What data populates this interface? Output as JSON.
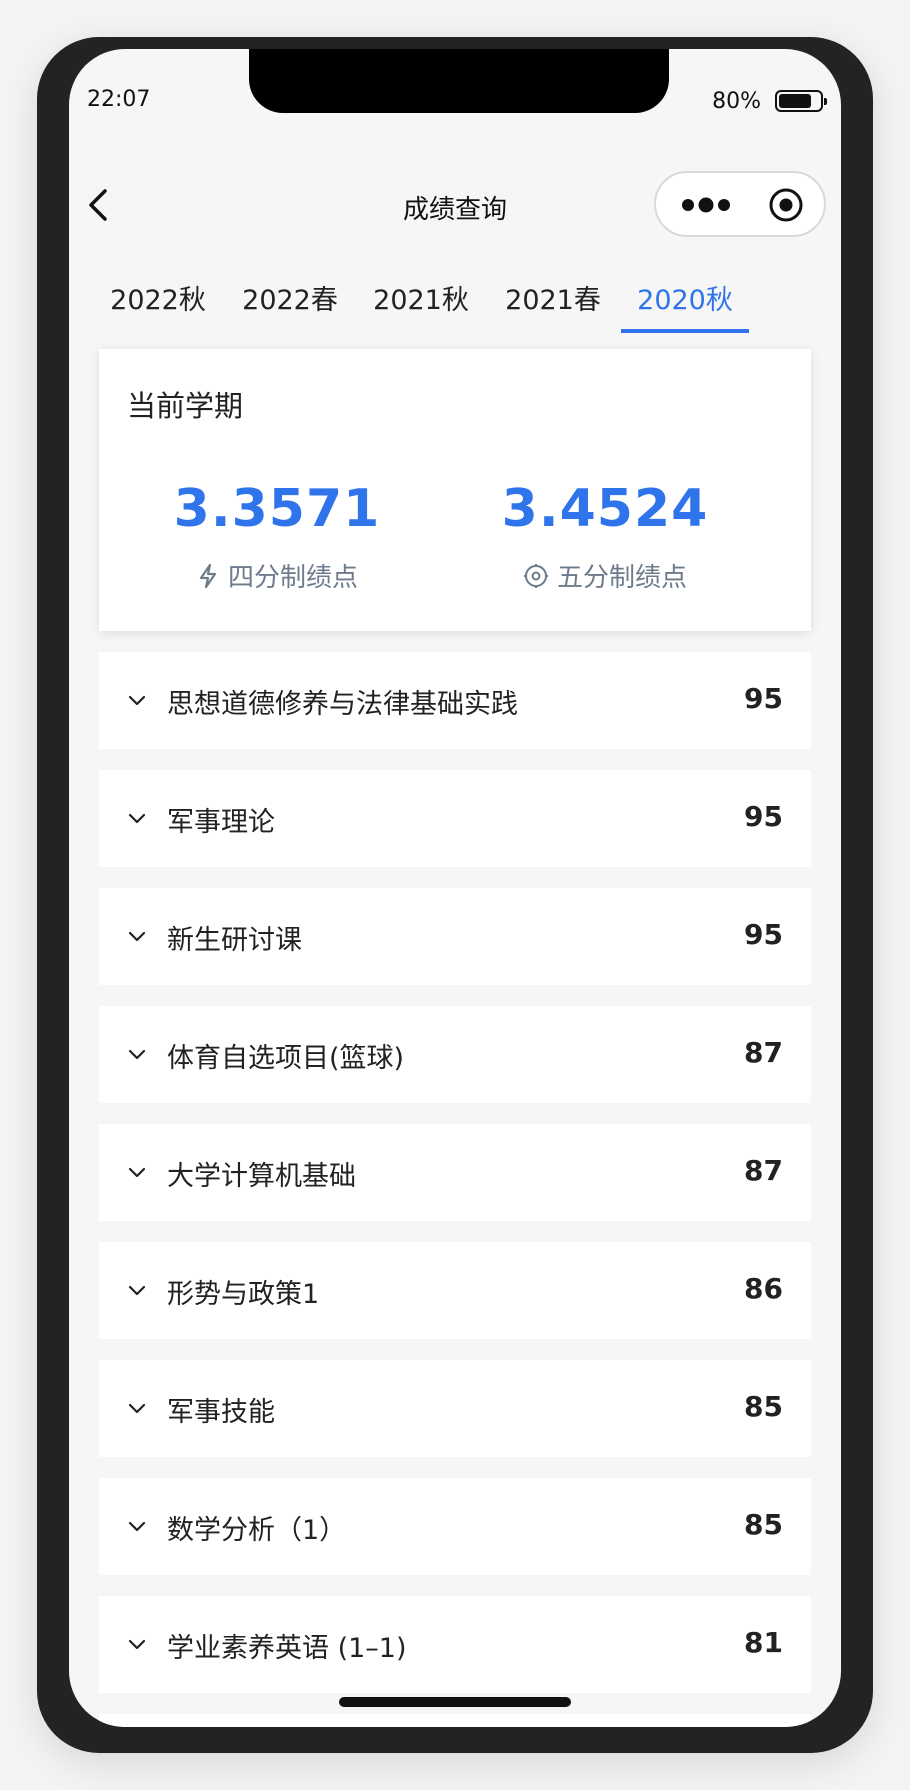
{
  "status_bar": {
    "time": "22:07",
    "battery_text": "80%",
    "battery_level": 0.8
  },
  "navbar": {
    "title": "成绩查询",
    "back_icon": "chevron-left-icon",
    "more_icon": "more-dots-icon",
    "close_icon": "target-circle-icon"
  },
  "tabs": [
    {
      "label": "2022秋",
      "active": false
    },
    {
      "label": "2022春",
      "active": false
    },
    {
      "label": "2021秋",
      "active": false
    },
    {
      "label": "2021春",
      "active": false
    },
    {
      "label": "2020秋",
      "active": true
    }
  ],
  "summary": {
    "title": "当前学期",
    "gpa4": {
      "value": "3.3571",
      "label": "四分制绩点",
      "icon": "lightning-icon"
    },
    "gpa5": {
      "value": "3.4524",
      "label": "五分制绩点",
      "icon": "target-icon"
    }
  },
  "courses": [
    {
      "name": "思想道德修养与法律基础实践",
      "score": "95"
    },
    {
      "name": "军事理论",
      "score": "95"
    },
    {
      "name": "新生研讨课",
      "score": "95"
    },
    {
      "name": "体育自选项目(篮球)",
      "score": "87"
    },
    {
      "name": "大学计算机基础",
      "score": "87"
    },
    {
      "name": "形势与政策1",
      "score": "86"
    },
    {
      "name": "军事技能",
      "score": "85"
    },
    {
      "name": "数学分析（1）",
      "score": "85"
    },
    {
      "name": "学业素养英语 (1–1)",
      "score": "81"
    }
  ],
  "colors": {
    "accent": "#2f74ea",
    "label_gray": "#6d7b8c",
    "background": "#f6f6f6"
  }
}
